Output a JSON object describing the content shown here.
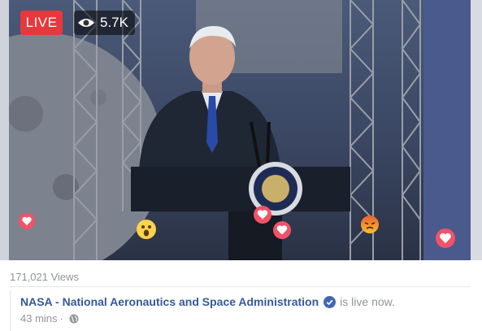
{
  "video": {
    "live_label": "LIVE",
    "viewer_count": "5.7K",
    "seal_text": "THE PRESIDENT OF THE UNITED STATES"
  },
  "reactions": [
    "love",
    "wow",
    "love",
    "love",
    "angry",
    "love"
  ],
  "footer": {
    "views": "171,021 Views",
    "page_name": "NASA - National Aeronautics and Space Administration",
    "status": "is live now.",
    "time": "43 mins",
    "separator": "·"
  },
  "colors": {
    "live_red": "#e8383d",
    "link_blue": "#365899",
    "verified_blue": "#4267b2",
    "meta_gray": "#90949c"
  }
}
